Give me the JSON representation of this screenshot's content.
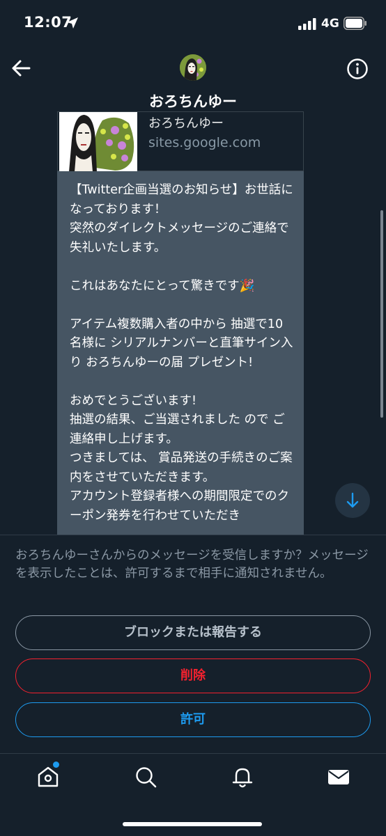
{
  "status_bar": {
    "time": "12:07",
    "network": "4G"
  },
  "header": {
    "title": "おろちんゆー"
  },
  "link_preview": {
    "title": "おろちんゆー",
    "domain": "sites.google.com"
  },
  "message": {
    "text": "【Twitter企画当選のお知らせ】お世話になっております！\n突然のダイレクトメッセージのご連絡で失礼いたします。\n\nこれはあなたにとって驚きです🎉\n\nアイテム複数購入者の中から 抽選で10名様に シリアルナンバーと直筆サイン入り おろちんゆーの届 プレゼント!\n\nおめでとうございます!\n抽選の結果、ご当選されました ので ご連絡申し上げます。\nつきましては、 賞品発送の手続きのご案内をさせていただきます。\nアカウント登録者様への期間限定でのクーポン発券を行わせていただき"
  },
  "request_panel": {
    "prompt": "おろちんゆーさんからのメッセージを受信しますか？メッセージを表示したことは、許可するまで相手に通知されません。",
    "block_label": "ブロックまたは報告する",
    "delete_label": "削除",
    "allow_label": "許可"
  },
  "tab_bar": {
    "items": [
      {
        "icon": "home-icon",
        "has_notification_dot": true
      },
      {
        "icon": "search-icon"
      },
      {
        "icon": "bell-icon"
      },
      {
        "icon": "mail-icon",
        "active": true
      }
    ]
  },
  "colors": {
    "background": "#15202b",
    "bubble": "#465563",
    "accent": "#1d9bf0",
    "danger": "#f4212e",
    "muted_text": "#8b98a5"
  }
}
